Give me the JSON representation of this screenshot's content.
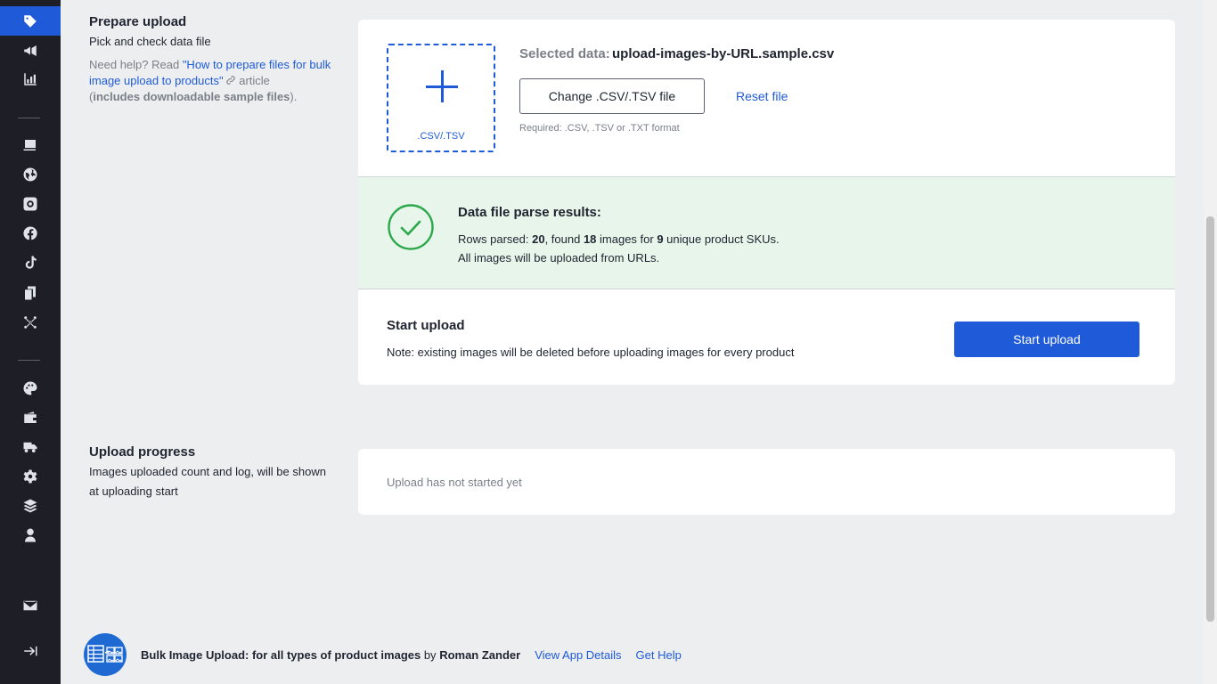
{
  "sidebar": {
    "icons": [
      "tag-icon",
      "megaphone-icon",
      "bar-chart-icon",
      "catalog-icon",
      "globe-icon",
      "instagram-icon",
      "facebook-icon",
      "tiktok-icon",
      "devices-icon",
      "network-icon",
      "palette-icon",
      "wallet-icon",
      "truck-icon",
      "gear-icon",
      "layers-icon",
      "user-icon",
      "mail-icon",
      "collapse-icon"
    ],
    "accent": "#1f5bd8"
  },
  "prepare": {
    "title": "Prepare upload",
    "subtitle": "Pick and check data file",
    "help_prefix": "Need help? Read ",
    "help_link": "\"How to prepare files for bulk image upload to products\"",
    "help_suffix": " article",
    "help_paren_open": "(",
    "help_bold": "includes downloadable sample files",
    "help_paren_close": ")."
  },
  "upload": {
    "dropzone_label": ".CSV/.TSV",
    "selected_label": "Selected data:",
    "selected_file": "upload-images-by-URL.sample.csv",
    "change_button": "Change .CSV/.TSV file",
    "reset_link": "Reset file",
    "required_note": "Required: .CSV, .TSV or .TXT format"
  },
  "parse_result": {
    "title": "Data file parse results:",
    "rows_label": "Rows parsed: ",
    "rows": "20",
    "found_label": ", found ",
    "images": "18",
    "images_label": " images for ",
    "skus": "9",
    "skus_label": " unique product SKUs.",
    "line2": "All images will be uploaded from URLs.",
    "status_color": "#2aa84a"
  },
  "start": {
    "title": "Start upload",
    "note": "Note: existing images will be deleted before uploading images for every product",
    "button": "Start upload"
  },
  "progress": {
    "title": "Upload progress",
    "subtitle_line1": "Images uploaded count and log, will be shown",
    "subtitle_line2": "at uploading start",
    "status": "Upload has not started yet"
  },
  "footer": {
    "app_name": "Bulk Image Upload: for all types of product images",
    "by": " by ",
    "author": "Roman Zander",
    "view_details": "View App Details",
    "get_help": "Get Help"
  }
}
